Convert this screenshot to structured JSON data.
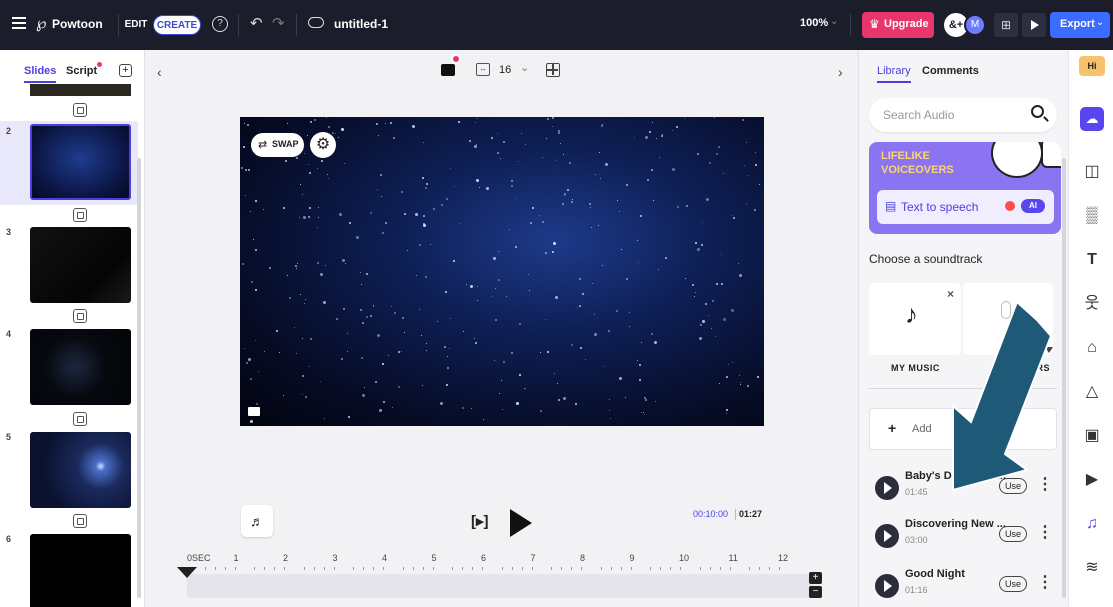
{
  "topbar": {
    "brand": "Powtoon",
    "edit_label": "EDIT",
    "create_label": "CREATE",
    "title": "untitled-1",
    "zoom": "100%",
    "upgrade_label": "Upgrade",
    "avatar_letter": "M",
    "export_label": "Export"
  },
  "left": {
    "tab_slides": "Slides",
    "tab_script": "Script",
    "slides": [
      {
        "num": "2"
      },
      {
        "num": "3"
      },
      {
        "num": "4"
      },
      {
        "num": "5"
      },
      {
        "num": "6"
      }
    ]
  },
  "toolbar": {
    "grid_value": "16"
  },
  "canvas": {
    "swap_label": "SWAP"
  },
  "timeline": {
    "time_current": "00:10:00",
    "time_total": "01:27",
    "ticks": [
      "0SEC",
      "1",
      "2",
      "3",
      "4",
      "5",
      "6",
      "7",
      "8",
      "9",
      "10",
      "11",
      "12"
    ]
  },
  "right": {
    "tab_library": "Library",
    "tab_comments": "Comments",
    "search_placeholder": "Search Audio",
    "promo_line1": "LIFELIKE",
    "promo_line2": "VOICEOVERS",
    "tts_label": "Text to speech",
    "ai_badge": "AI",
    "soundtrack_heading": "Choose a soundtrack",
    "my_music_label": "MY MUSIC",
    "voiceovers_label": "OVERS",
    "add_label": "Add",
    "tracks": [
      {
        "name": "Baby's Dream (Or...",
        "duration": "01:45",
        "use": "Use"
      },
      {
        "name": "Discovering New ...",
        "duration": "03:00",
        "use": "Use"
      },
      {
        "name": "Good Night",
        "duration": "01:16",
        "use": "Use"
      }
    ]
  },
  "colors": {
    "accent": "#5a46f0",
    "upgrade": "#e8356d",
    "export": "#3b6bff",
    "arrow": "#1e5a78"
  }
}
